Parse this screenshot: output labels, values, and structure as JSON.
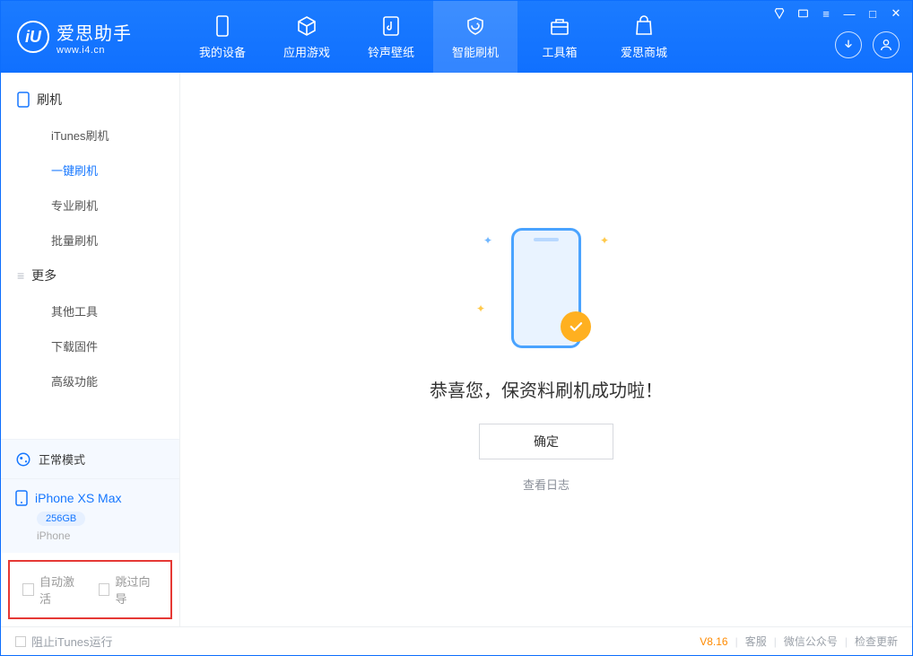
{
  "app": {
    "name": "爱思助手",
    "url": "www.i4.cn"
  },
  "winctrls": {
    "tshirt": "衬",
    "menu": "≡",
    "min": "—",
    "max": "□",
    "close": "✕",
    "book": "▭"
  },
  "tabs": [
    {
      "label": "我的设备"
    },
    {
      "label": "应用游戏"
    },
    {
      "label": "铃声壁纸"
    },
    {
      "label": "智能刷机"
    },
    {
      "label": "工具箱"
    },
    {
      "label": "爱思商城"
    }
  ],
  "sidebar": {
    "section1": {
      "title": "刷机",
      "items": [
        "iTunes刷机",
        "一键刷机",
        "专业刷机",
        "批量刷机"
      ]
    },
    "section2": {
      "title": "更多",
      "items": [
        "其他工具",
        "下载固件",
        "高级功能"
      ]
    },
    "mode": "正常模式",
    "device": {
      "name": "iPhone XS Max",
      "storage": "256GB",
      "model": "iPhone"
    },
    "options": {
      "auto_activate": "自动激活",
      "skip_guide": "跳过向导"
    }
  },
  "main": {
    "success": "恭喜您，保资料刷机成功啦！",
    "confirm": "确定",
    "viewlog": "查看日志"
  },
  "footer": {
    "block_itunes": "阻止iTunes运行",
    "version": "V8.16",
    "support": "客服",
    "wechat": "微信公众号",
    "update": "检查更新"
  }
}
